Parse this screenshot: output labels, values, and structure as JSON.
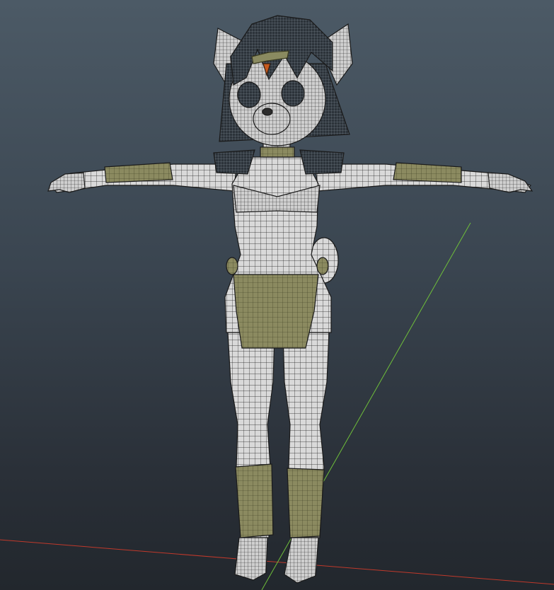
{
  "viewport": {
    "kind": "3d-modeling-viewport",
    "display_mode": "wireframe-on-shaded",
    "background_top": "#4c5a66",
    "background_bottom": "#22272d"
  },
  "scene": {
    "model": "t-pose-character-mesh",
    "mesh_color": "#d8d8d8",
    "wire_color": "#1a1a1a",
    "accessory_color": "#8a8a60",
    "axis_x_color": "#c0392b",
    "axis_z_color": "#6fbf3a"
  }
}
